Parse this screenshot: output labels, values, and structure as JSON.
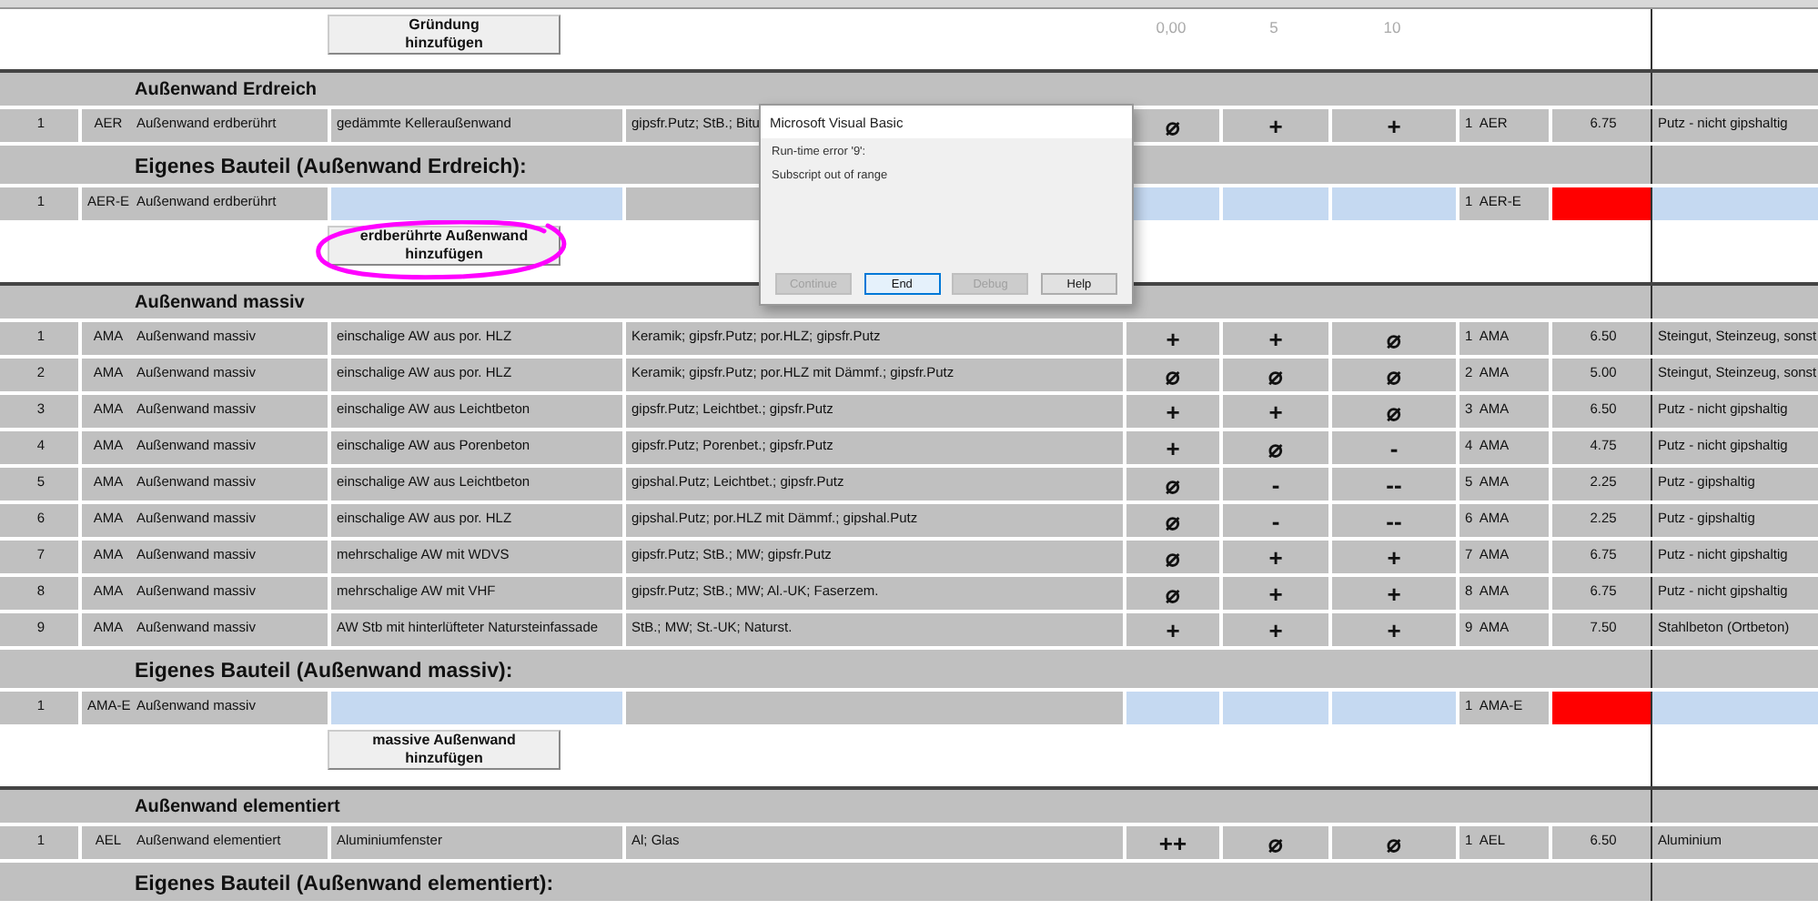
{
  "top": {
    "button": "Gründung\nhinzufügen",
    "scale": [
      "0,00",
      "5",
      "10"
    ]
  },
  "sections": [
    {
      "title": "Außenwand Erdreich",
      "rows": [
        {
          "nr": "1",
          "code": "AER",
          "name": "Außenwand erdberührt",
          "description": "gedämmte Kelleraußenwand",
          "material": "gipsfr.Putz; StB.; Bitu",
          "ratings": [
            "⌀",
            "+",
            "+"
          ],
          "ref": "1  AER",
          "value": "6.75",
          "category": "Putz - nicht gipshaltig"
        }
      ],
      "custom_title": "Eigenes Bauteil (Außenwand Erdreich):",
      "custom_rows": [
        {
          "nr": "1",
          "code": "AER-E",
          "name": "Außenwand erdberührt",
          "ref": "1  AER-E",
          "value_missing": true
        }
      ],
      "button": {
        "label": "erdberührte Außenwand\nhinzufügen",
        "highlighted": true
      }
    },
    {
      "title": "Außenwand massiv",
      "rows": [
        {
          "nr": "1",
          "code": "AMA",
          "name": "Außenwand massiv",
          "description": "einschalige AW aus por. HLZ",
          "material": "Keramik; gipsfr.Putz; por.HLZ; gipsfr.Putz",
          "ratings": [
            "+",
            "+",
            "⌀"
          ],
          "ref": "1  AMA",
          "value": "6.50",
          "category": "Steingut, Steinzeug, sonst"
        },
        {
          "nr": "2",
          "code": "AMA",
          "name": "Außenwand massiv",
          "description": "einschalige AW aus por. HLZ",
          "material": "Keramik; gipsfr.Putz; por.HLZ mit Dämmf.; gipsfr.Putz",
          "ratings": [
            "⌀",
            "⌀",
            "⌀"
          ],
          "ref": "2  AMA",
          "value": "5.00",
          "category": "Steingut, Steinzeug, sonst"
        },
        {
          "nr": "3",
          "code": "AMA",
          "name": "Außenwand massiv",
          "description": "einschalige AW aus Leichtbeton",
          "material": "gipsfr.Putz; Leichtbet.; gipsfr.Putz",
          "ratings": [
            "+",
            "+",
            "⌀"
          ],
          "ref": "3  AMA",
          "value": "6.50",
          "category": "Putz - nicht gipshaltig"
        },
        {
          "nr": "4",
          "code": "AMA",
          "name": "Außenwand massiv",
          "description": "einschalige AW aus Porenbeton",
          "material": "gipsfr.Putz; Porenbet.; gipsfr.Putz",
          "ratings": [
            "+",
            "⌀",
            "-"
          ],
          "ref": "4  AMA",
          "value": "4.75",
          "category": "Putz - nicht gipshaltig"
        },
        {
          "nr": "5",
          "code": "AMA",
          "name": "Außenwand massiv",
          "description": "einschalige AW aus Leichtbeton",
          "material": "gipshal.Putz; Leichtbet.; gipsfr.Putz",
          "ratings": [
            "⌀",
            "-",
            "--"
          ],
          "ref": "5  AMA",
          "value": "2.25",
          "category": "Putz - gipshaltig"
        },
        {
          "nr": "6",
          "code": "AMA",
          "name": "Außenwand massiv",
          "description": "einschalige AW aus por. HLZ",
          "material": "gipshal.Putz; por.HLZ mit Dämmf.; gipshal.Putz",
          "ratings": [
            "⌀",
            "-",
            "--"
          ],
          "ref": "6  AMA",
          "value": "2.25",
          "category": "Putz - gipshaltig"
        },
        {
          "nr": "7",
          "code": "AMA",
          "name": "Außenwand massiv",
          "description": "mehrschalige AW mit WDVS",
          "material": "gipsfr.Putz; StB.; MW; gipsfr.Putz",
          "ratings": [
            "⌀",
            "+",
            "+"
          ],
          "ref": "7  AMA",
          "value": "6.75",
          "category": "Putz - nicht gipshaltig"
        },
        {
          "nr": "8",
          "code": "AMA",
          "name": "Außenwand massiv",
          "description": "mehrschalige AW mit VHF",
          "material": "gipsfr.Putz; StB.; MW; Al.-UK; Faserzem.",
          "ratings": [
            "⌀",
            "+",
            "+"
          ],
          "ref": "8  AMA",
          "value": "6.75",
          "category": "Putz - nicht gipshaltig"
        },
        {
          "nr": "9",
          "code": "AMA",
          "name": "Außenwand massiv",
          "description": "AW Stb mit hinterlüfteter Natursteinfassade",
          "material": "StB.; MW; St.-UK; Naturst.",
          "ratings": [
            "+",
            "+",
            "+"
          ],
          "ref": "9  AMA",
          "value": "7.50",
          "category": "Stahlbeton (Ortbeton)"
        }
      ],
      "custom_title": "Eigenes Bauteil (Außenwand massiv):",
      "custom_rows": [
        {
          "nr": "1",
          "code": "AMA-E",
          "name": "Außenwand massiv",
          "ref": "1  AMA-E",
          "value_missing": true
        }
      ],
      "button": {
        "label": "massive Außenwand\nhinzufügen",
        "highlighted": false
      }
    },
    {
      "title": "Außenwand elementiert",
      "rows": [
        {
          "nr": "1",
          "code": "AEL",
          "name": "Außenwand elementiert",
          "description": "Aluminiumfenster",
          "material": "Al; Glas",
          "ratings": [
            "++",
            "⌀",
            "⌀"
          ],
          "ref": "1  AEL",
          "value": "6.50",
          "category": "Aluminium"
        }
      ],
      "custom_title": "Eigenes Bauteil (Außenwand elementiert):"
    }
  ],
  "dialog": {
    "title": "Microsoft Visual Basic",
    "lines": [
      "Run-time error '9':",
      "Subscript out of range"
    ],
    "buttons": [
      {
        "label": "Continue",
        "disabled": true,
        "focused": false
      },
      {
        "label": "End",
        "disabled": false,
        "focused": true
      },
      {
        "label": "Debug",
        "disabled": true,
        "focused": false
      },
      {
        "label": "Help",
        "disabled": false,
        "focused": false
      }
    ]
  }
}
